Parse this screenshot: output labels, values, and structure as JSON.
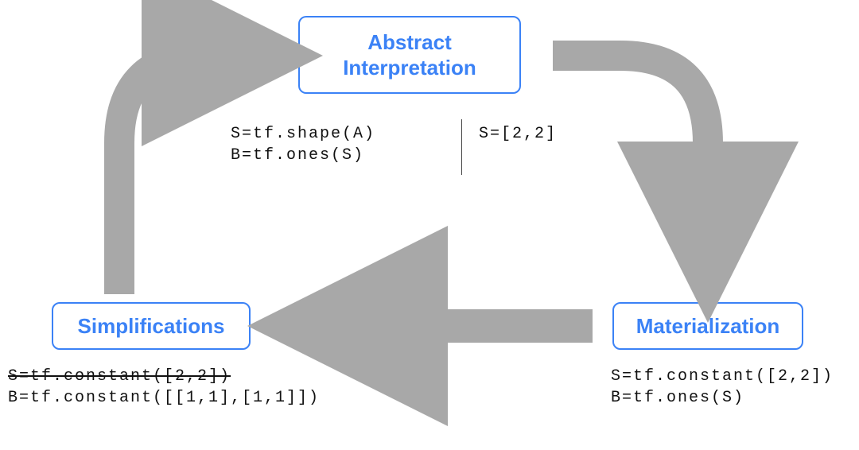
{
  "boxes": {
    "abstract_line1": "Abstract",
    "abstract_line2": "Interpretation",
    "materialization": "Materialization",
    "simplifications": "Simplifications"
  },
  "center_code": {
    "left_line1": "S=tf.shape(A)",
    "left_line2": "B=tf.ones(S)",
    "right_line1": "S=[2,2]"
  },
  "materialization_code": {
    "line1": "S=tf.constant([2,2])",
    "line2": "B=tf.ones(S)"
  },
  "simplifications_code": {
    "line1_struck": "S=tf.constant([2,2])",
    "line2": "B=tf.constant([[1,1],[1,1]])"
  },
  "arrow_color": "#a8a8a8"
}
